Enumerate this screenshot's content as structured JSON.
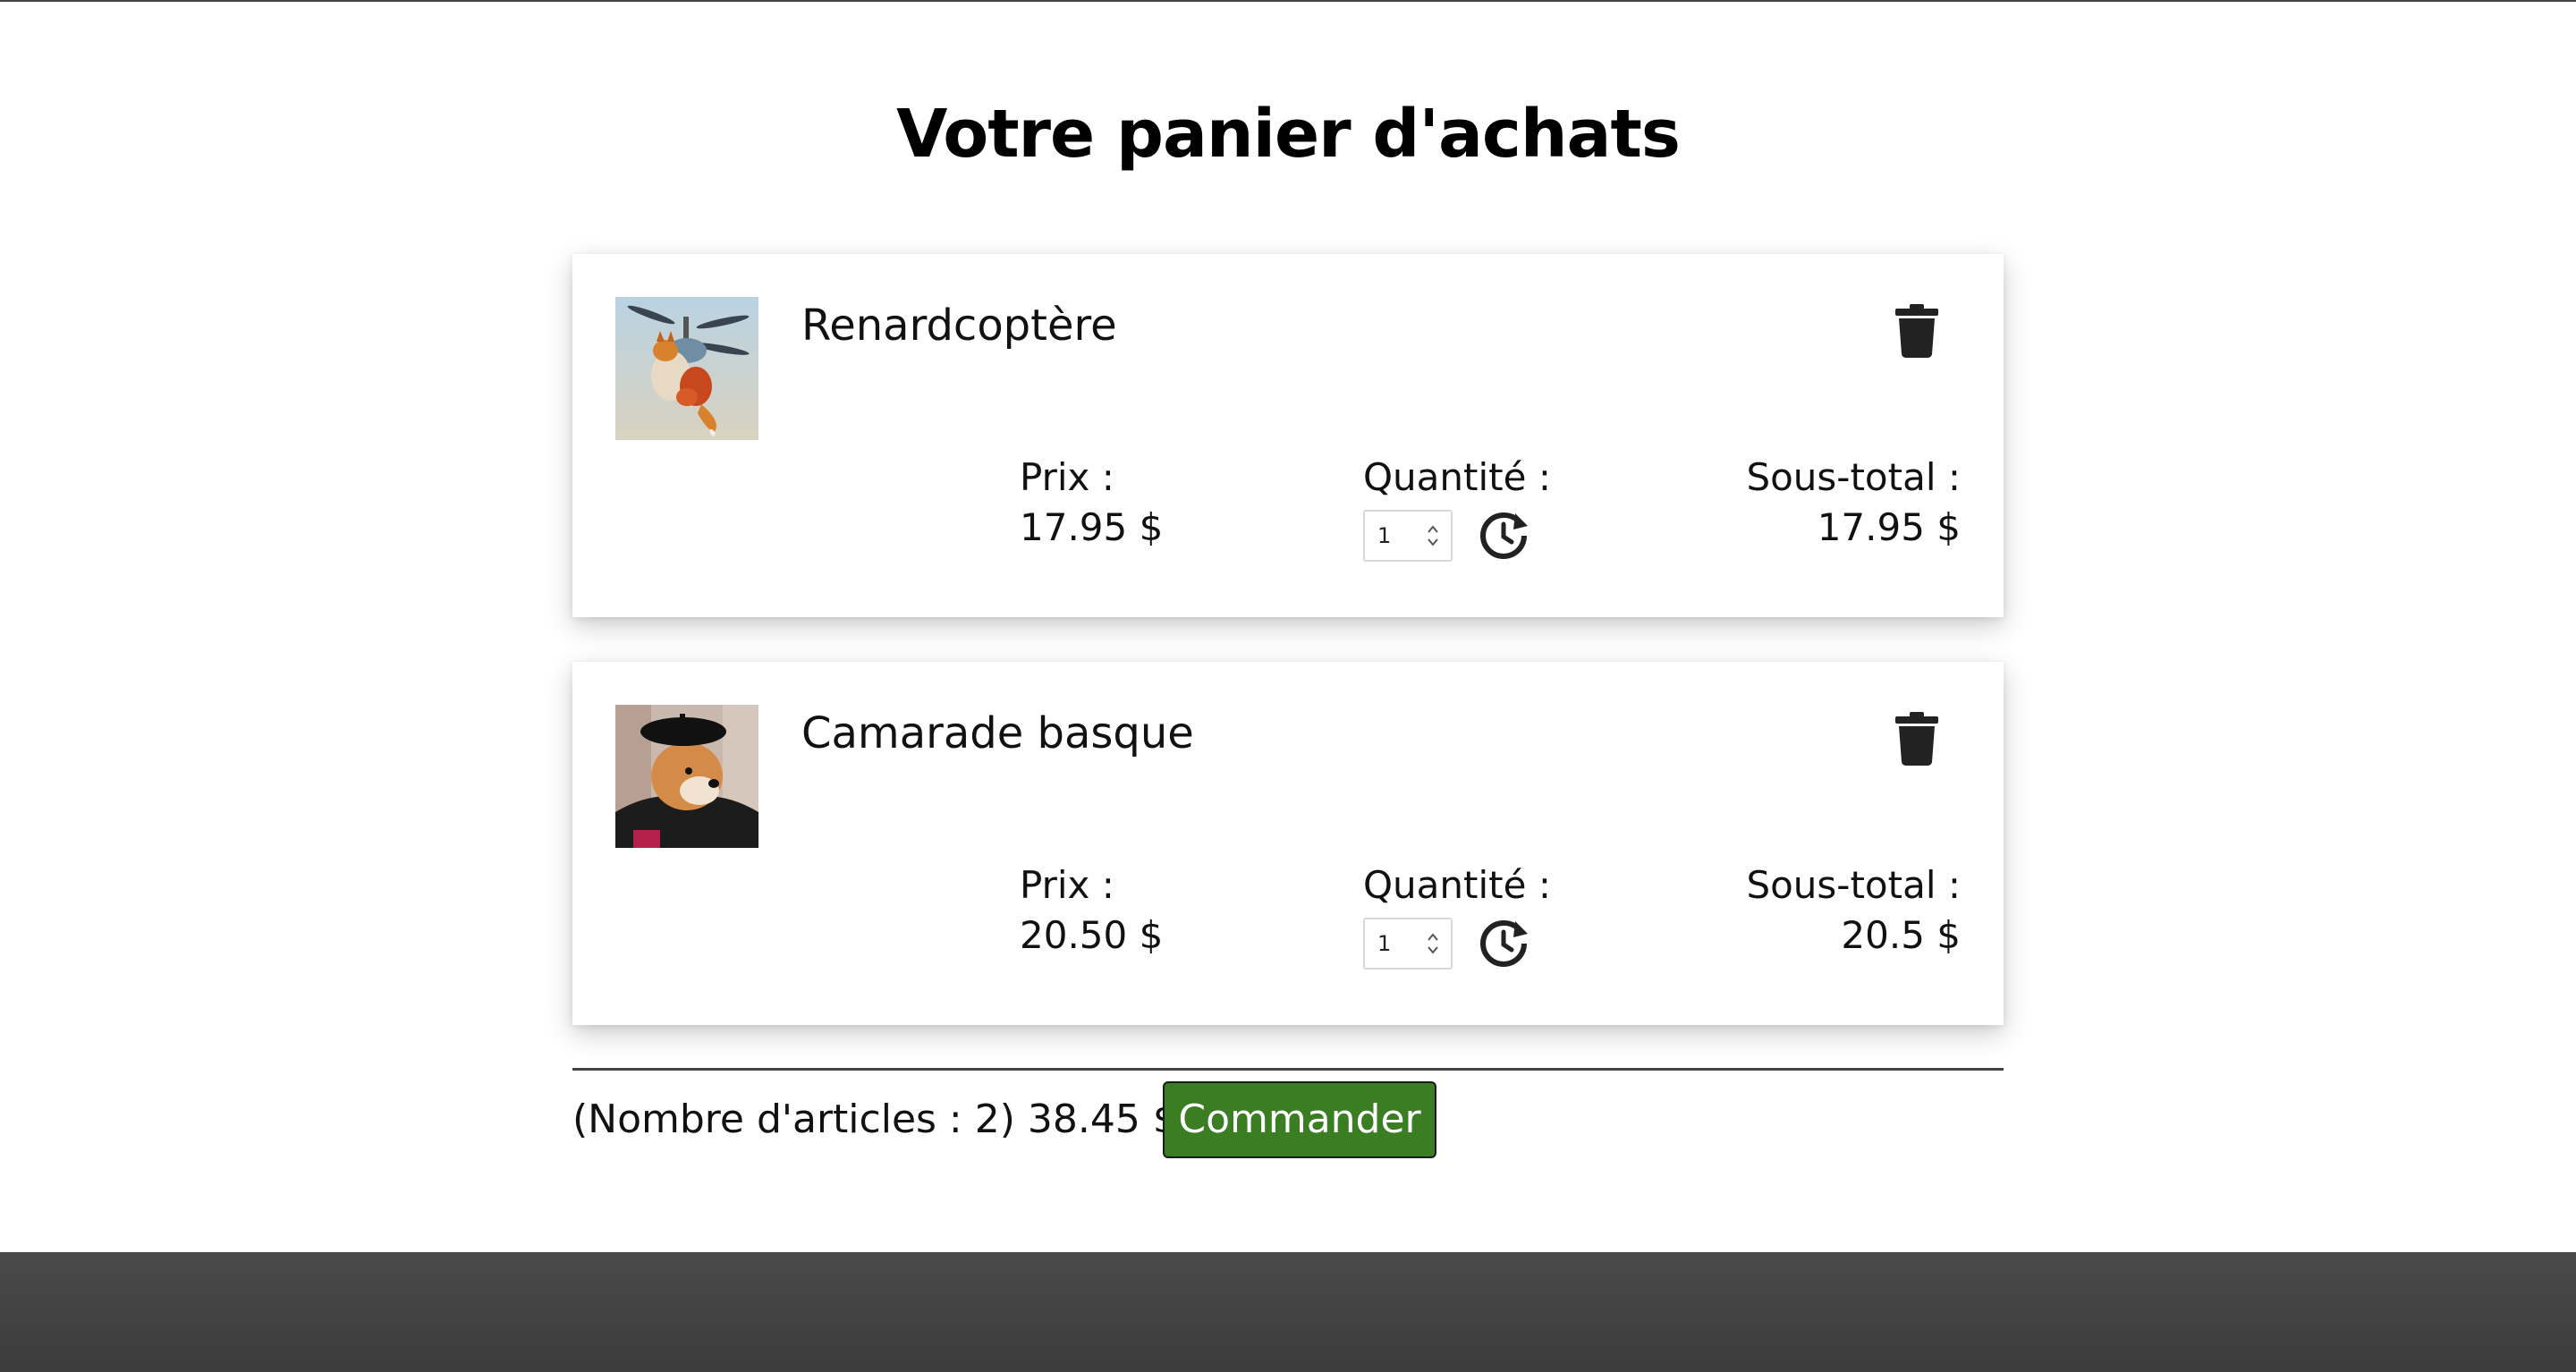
{
  "page": {
    "title": "Votre panier d'achats"
  },
  "cart": {
    "items": [
      {
        "name": "Renardcoptère",
        "image_icon": "fox-helicopter-thumbnail",
        "price_label": "Prix :",
        "price": "17.95 $",
        "quantity_label": "Quantité :",
        "quantity": "1",
        "subtotal_label": "Sous-total :",
        "subtotal": "17.95 $"
      },
      {
        "name": "Camarade basque",
        "image_icon": "dog-beret-thumbnail",
        "price_label": "Prix :",
        "price": "20.50 $",
        "quantity_label": "Quantité :",
        "quantity": "1",
        "subtotal_label": "Sous-total :",
        "subtotal": "20.5 $"
      }
    ],
    "summary": "(Nombre d'articles : 2) 38.45 $",
    "order_button_label": "Commander"
  },
  "colors": {
    "order_button": "#3a7d22",
    "footer": "#4a4a4a",
    "icon": "#222222"
  },
  "icons": {
    "delete": "trash-icon",
    "reset_quantity": "history-reset-icon"
  }
}
